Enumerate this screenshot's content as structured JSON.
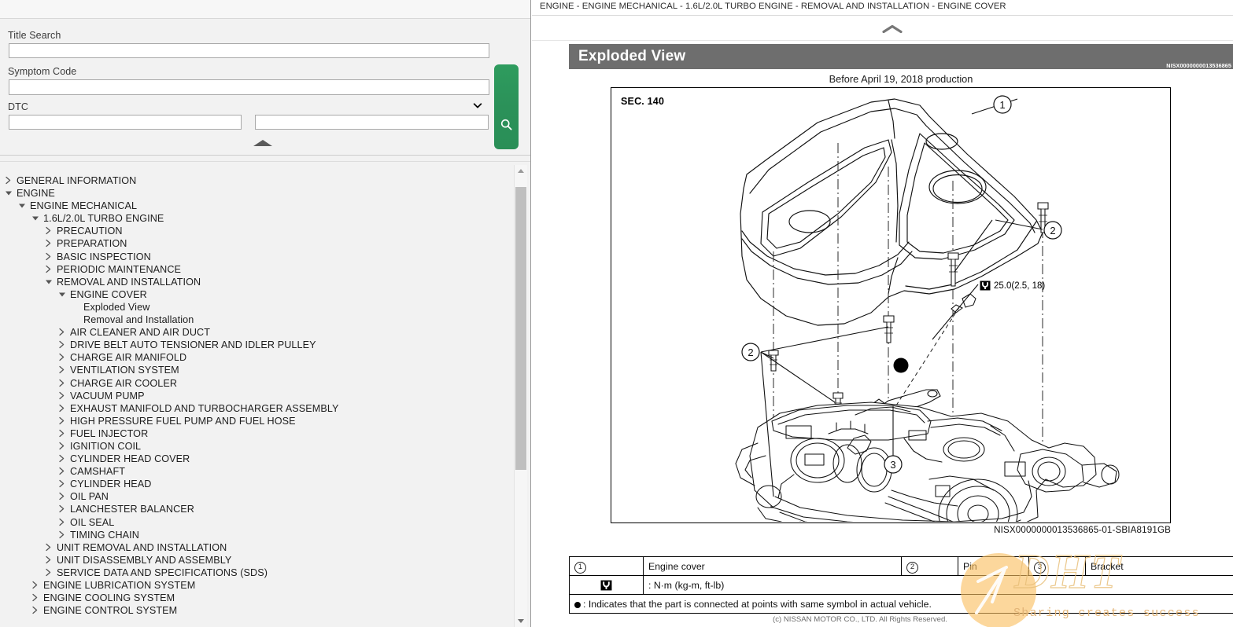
{
  "search": {
    "title_search_label": "Title Search",
    "title_search_value": "",
    "title_search_placeholder": "",
    "symptom_code_label": "Symptom Code",
    "symptom_code_value": "",
    "symptom_code_options": [
      ""
    ],
    "dtc_label": "DTC",
    "dtc_from_value": "",
    "dtc_to_value": "",
    "search_icon": "search-icon",
    "collapse_icon": "collapse-up-icon"
  },
  "tree": {
    "items": [
      {
        "label": "GENERAL INFORMATION",
        "indent": 0,
        "state": "collapsed"
      },
      {
        "label": "ENGINE",
        "indent": 0,
        "state": "expanded"
      },
      {
        "label": "ENGINE MECHANICAL",
        "indent": 1,
        "state": "expanded"
      },
      {
        "label": "1.6L/2.0L TURBO ENGINE",
        "indent": 2,
        "state": "expanded"
      },
      {
        "label": "PRECAUTION",
        "indent": 3,
        "state": "collapsed"
      },
      {
        "label": "PREPARATION",
        "indent": 3,
        "state": "collapsed"
      },
      {
        "label": "BASIC INSPECTION",
        "indent": 3,
        "state": "collapsed"
      },
      {
        "label": "PERIODIC MAINTENANCE",
        "indent": 3,
        "state": "collapsed"
      },
      {
        "label": "REMOVAL AND INSTALLATION",
        "indent": 3,
        "state": "expanded"
      },
      {
        "label": "ENGINE COVER",
        "indent": 4,
        "state": "expanded"
      },
      {
        "label": "Exploded View",
        "indent": 5,
        "state": "leaf"
      },
      {
        "label": "Removal and Installation",
        "indent": 5,
        "state": "leaf"
      },
      {
        "label": "AIR CLEANER AND AIR DUCT",
        "indent": 4,
        "state": "collapsed"
      },
      {
        "label": "DRIVE BELT AUTO TENSIONER AND IDLER PULLEY",
        "indent": 4,
        "state": "collapsed"
      },
      {
        "label": "CHARGE AIR MANIFOLD",
        "indent": 4,
        "state": "collapsed"
      },
      {
        "label": "VENTILATION SYSTEM",
        "indent": 4,
        "state": "collapsed"
      },
      {
        "label": "CHARGE AIR COOLER",
        "indent": 4,
        "state": "collapsed"
      },
      {
        "label": "VACUUM PUMP",
        "indent": 4,
        "state": "collapsed"
      },
      {
        "label": "EXHAUST MANIFOLD AND TURBOCHARGER ASSEMBLY",
        "indent": 4,
        "state": "collapsed"
      },
      {
        "label": "HIGH PRESSURE FUEL PUMP AND FUEL HOSE",
        "indent": 4,
        "state": "collapsed"
      },
      {
        "label": "FUEL INJECTOR",
        "indent": 4,
        "state": "collapsed"
      },
      {
        "label": "IGNITION COIL",
        "indent": 4,
        "state": "collapsed"
      },
      {
        "label": "CYLINDER HEAD COVER",
        "indent": 4,
        "state": "collapsed"
      },
      {
        "label": "CAMSHAFT",
        "indent": 4,
        "state": "collapsed"
      },
      {
        "label": "CYLINDER HEAD",
        "indent": 4,
        "state": "collapsed"
      },
      {
        "label": "OIL PAN",
        "indent": 4,
        "state": "collapsed"
      },
      {
        "label": "LANCHESTER BALANCER",
        "indent": 4,
        "state": "collapsed"
      },
      {
        "label": "OIL SEAL",
        "indent": 4,
        "state": "collapsed"
      },
      {
        "label": "TIMING CHAIN",
        "indent": 4,
        "state": "collapsed"
      },
      {
        "label": "UNIT REMOVAL AND INSTALLATION",
        "indent": 3,
        "state": "collapsed"
      },
      {
        "label": "UNIT DISASSEMBLY AND ASSEMBLY",
        "indent": 3,
        "state": "collapsed"
      },
      {
        "label": "SERVICE DATA AND SPECIFICATIONS (SDS)",
        "indent": 3,
        "state": "collapsed"
      },
      {
        "label": "ENGINE LUBRICATION SYSTEM",
        "indent": 2,
        "state": "collapsed"
      },
      {
        "label": "ENGINE COOLING SYSTEM",
        "indent": 2,
        "state": "collapsed"
      },
      {
        "label": "ENGINE CONTROL SYSTEM",
        "indent": 2,
        "state": "collapsed"
      }
    ]
  },
  "document": {
    "breadcrumb": "ENGINE - ENGINE MECHANICAL - 1.6L/2.0L TURBO ENGINE - REMOVAL AND INSTALLATION - ENGINE COVER",
    "collapse_icon": "chevron-up-icon",
    "section_title": "Exploded View",
    "section_code": "NISX0000000013536865",
    "figure_caption": "Before April 19, 2018 production",
    "figure": {
      "sec_label": "SEC. 140",
      "torque_note": "25.0(2.5, 18)",
      "torque_icon": "torque-wrench-icon",
      "callouts": [
        "1",
        "2",
        "2",
        "3"
      ]
    },
    "figure_id": "NISX0000000013536865-01-SBIA8191GB",
    "parts_table": {
      "rows": [
        [
          {
            "num": "1",
            "name": "Engine cover"
          },
          {
            "num": "2",
            "name": "Pin"
          },
          {
            "num": "3",
            "name": "Bracket"
          }
        ]
      ],
      "unit_row": {
        "symbol": "torque-wrench-icon",
        "text": ": N·m (kg-m, ft-lb)"
      },
      "note_row": {
        "symbol": "filled-dot",
        "text": ": Indicates that the part is connected at points with same symbol in actual vehicle."
      }
    },
    "copyright": "(c) NISSAN MOTOR CO., LTD. All Rights Reserved."
  },
  "watermark": {
    "brand": "DHT",
    "tagline": "Sharing creates success"
  },
  "colors": {
    "accent_green": "#2b9159",
    "section_bar": "#6e6e6e",
    "panel_bg": "#f2f2f2",
    "watermark_orange": "#e8be78"
  }
}
